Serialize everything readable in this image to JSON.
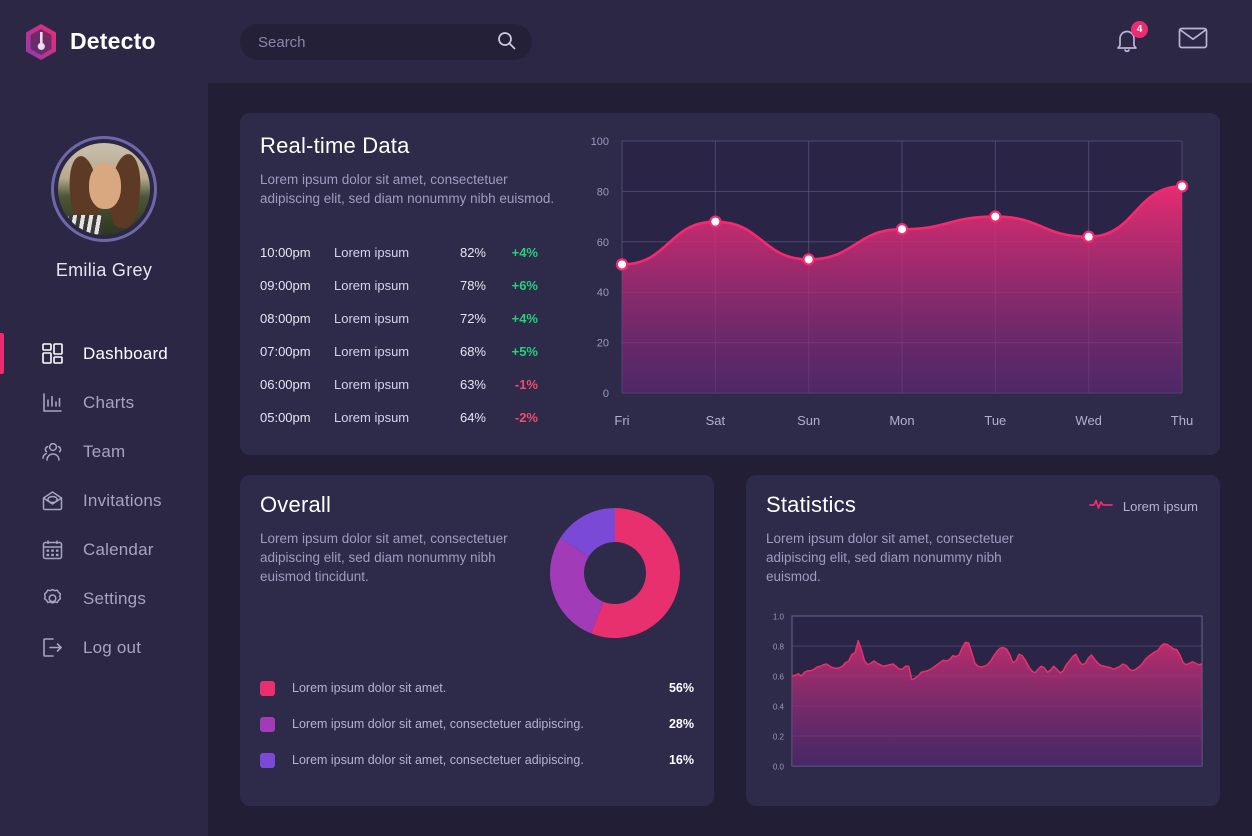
{
  "brand": {
    "name": "Detecto",
    "logo_icon": "hexagon-detector-logo"
  },
  "search": {
    "placeholder": "Search",
    "value": "",
    "icon": "search-icon"
  },
  "topbar": {
    "notifications": {
      "icon": "bell-icon",
      "count": "4"
    },
    "messages": {
      "icon": "envelope-icon"
    }
  },
  "sidebar": {
    "user": {
      "name": "Emilia Grey",
      "avatar": "user-avatar-photo"
    },
    "items": [
      {
        "label": "Dashboard",
        "icon": "dashboard-grid-icon",
        "active": true
      },
      {
        "label": "Charts",
        "icon": "bar-chart-icon",
        "active": false
      },
      {
        "label": "Team",
        "icon": "people-icon",
        "active": false
      },
      {
        "label": "Invitations",
        "icon": "open-envelope-icon",
        "active": false
      },
      {
        "label": "Calendar",
        "icon": "calendar-icon",
        "active": false
      },
      {
        "label": "Settings",
        "icon": "gear-icon",
        "active": false
      },
      {
        "label": "Log out",
        "icon": "logout-arrow-icon",
        "active": false
      }
    ]
  },
  "realtime": {
    "title": "Real-time Data",
    "description": "Lorem ipsum dolor sit amet, consectetuer adipiscing elit, sed diam nonummy nibh euismod.",
    "rows": [
      {
        "time": "10:00pm",
        "label": "Lorem ipsum",
        "value": "82%",
        "delta": "+4%",
        "dir": "up"
      },
      {
        "time": "09:00pm",
        "label": "Lorem ipsum",
        "value": "78%",
        "delta": "+6%",
        "dir": "up"
      },
      {
        "time": "08:00pm",
        "label": "Lorem ipsum",
        "value": "72%",
        "delta": "+4%",
        "dir": "up"
      },
      {
        "time": "07:00pm",
        "label": "Lorem ipsum",
        "value": "68%",
        "delta": "+5%",
        "dir": "up"
      },
      {
        "time": "06:00pm",
        "label": "Lorem ipsum",
        "value": "63%",
        "delta": "-1%",
        "dir": "down"
      },
      {
        "time": "05:00pm",
        "label": "Lorem ipsum",
        "value": "64%",
        "delta": "-2%",
        "dir": "down"
      }
    ]
  },
  "overall": {
    "title": "Overall",
    "description": "Lorem ipsum dolor sit amet, consectetuer adipiscing elit, sed diam nonummy nibh euismod tincidunt.",
    "legend": [
      {
        "label": "Lorem ipsum dolor sit amet.",
        "pct": "56%",
        "color": "#e8306f"
      },
      {
        "label": "Lorem ipsum dolor sit amet, consectetuer adipiscing.",
        "pct": "28%",
        "color": "#a23bb8"
      },
      {
        "label": "Lorem ipsum dolor sit amet, consectetuer adipiscing.",
        "pct": "16%",
        "color": "#7a4ad6"
      }
    ]
  },
  "statistics": {
    "title": "Statistics",
    "description": "Lorem ipsum dolor sit amet, consectetuer adipiscing elit, sed diam nonummy nibh euismod.",
    "legend_label": "Lorem ipsum",
    "legend_icon": "pulse-line-icon"
  },
  "colors": {
    "page_bg": "#211e36",
    "sidebar_bg": "#2b2745",
    "card_bg": "#2e2a4a",
    "accent_pink": "#ee2b71",
    "accent_purple": "#7a4ad6",
    "up_green": "#27d07a",
    "down_red": "#ef4c6e"
  },
  "chart_data": [
    {
      "type": "area",
      "id": "realtime-line-chart",
      "title": "Real-time Data",
      "x": [
        "Fri",
        "Sat",
        "Sun",
        "Mon",
        "Tue",
        "Wed",
        "Thu"
      ],
      "values": [
        51,
        68,
        53,
        65,
        70,
        62,
        82
      ],
      "ylim": [
        0,
        100
      ],
      "yticks": [
        0,
        20,
        40,
        60,
        80,
        100
      ],
      "xlabel": "",
      "ylabel": "",
      "grid": true,
      "legend": "none",
      "line_color": "#f5296f",
      "marker": "white-dot"
    },
    {
      "type": "pie",
      "id": "overall-donut-chart",
      "title": "Overall",
      "labels": [
        "Lorem ipsum dolor sit amet.",
        "Lorem ipsum dolor sit amet, consectetuer adipiscing.",
        "Lorem ipsum dolor sit amet, consectetuer adipiscing."
      ],
      "values": [
        56,
        28,
        16
      ],
      "colors": [
        "#e8306f",
        "#a23bb8",
        "#7a4ad6"
      ],
      "donut": true,
      "legend": "bottom"
    },
    {
      "type": "area",
      "id": "statistics-area-chart",
      "title": "Statistics",
      "ylim": [
        0.0,
        1.0
      ],
      "yticks": [
        "0.0",
        "0.2",
        "0.4",
        "0.6",
        "0.8",
        "1.0"
      ],
      "xlabel": "",
      "ylabel": "",
      "grid": true,
      "legend": "Lorem ipsum",
      "line_color": "#e8306f",
      "values": [
        0.6,
        0.605,
        0.615,
        0.6,
        0.625,
        0.635,
        0.635,
        0.645,
        0.66,
        0.665,
        0.675,
        0.68,
        0.665,
        0.655,
        0.65,
        0.655,
        0.665,
        0.69,
        0.7,
        0.745,
        0.755,
        0.835,
        0.775,
        0.7,
        0.675,
        0.685,
        0.7,
        0.685,
        0.675,
        0.665,
        0.67,
        0.675,
        0.68,
        0.665,
        0.645,
        0.645,
        0.665,
        0.665,
        0.575,
        0.585,
        0.6,
        0.625,
        0.63,
        0.635,
        0.645,
        0.66,
        0.675,
        0.69,
        0.705,
        0.7,
        0.71,
        0.735,
        0.73,
        0.74,
        0.79,
        0.825,
        0.82,
        0.755,
        0.685,
        0.665,
        0.66,
        0.665,
        0.675,
        0.7,
        0.735,
        0.765,
        0.785,
        0.79,
        0.78,
        0.745,
        0.69,
        0.7,
        0.745,
        0.735,
        0.705,
        0.665,
        0.635,
        0.62,
        0.645,
        0.665,
        0.655,
        0.625,
        0.64,
        0.665,
        0.645,
        0.62,
        0.635,
        0.675,
        0.7,
        0.73,
        0.745,
        0.7,
        0.675,
        0.685,
        0.72,
        0.74,
        0.71,
        0.685,
        0.67,
        0.665,
        0.66,
        0.655,
        0.645,
        0.655,
        0.665,
        0.68,
        0.67,
        0.645,
        0.635,
        0.645,
        0.66,
        0.68,
        0.71,
        0.73,
        0.745,
        0.76,
        0.77,
        0.8,
        0.815,
        0.81,
        0.795,
        0.78,
        0.775,
        0.74,
        0.69,
        0.675,
        0.685,
        0.695,
        0.685,
        0.675,
        0.68
      ]
    }
  ]
}
